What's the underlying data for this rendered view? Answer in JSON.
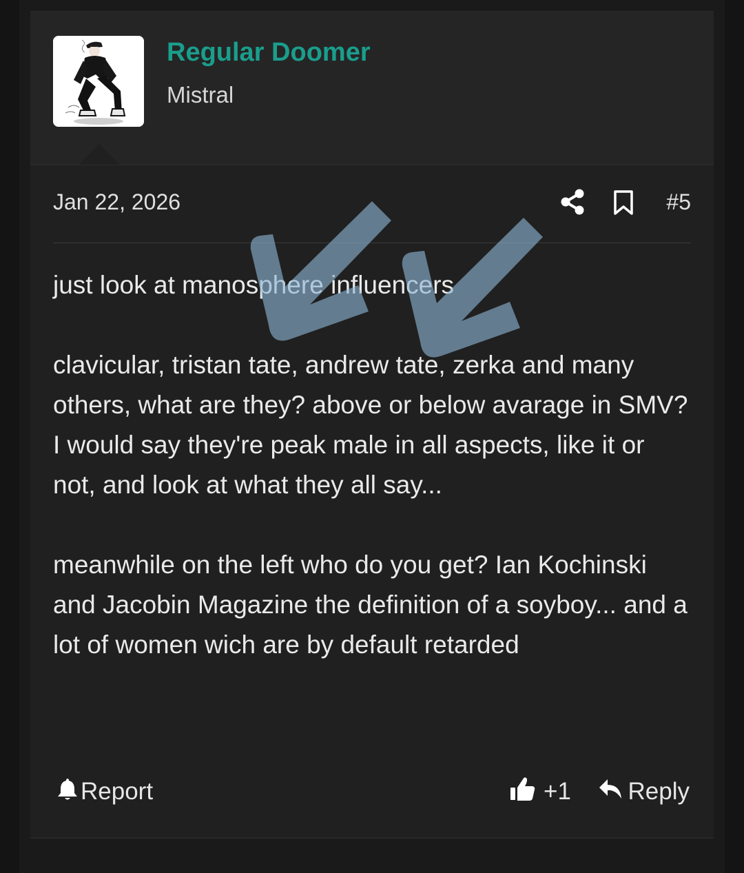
{
  "user": {
    "name": "Regular Doomer",
    "title": "Mistral"
  },
  "post": {
    "date": "Jan 22, 2026",
    "number": "#5",
    "paragraphs": [
      "just look at manosphere influencers",
      "clavicular, tristan tate, andrew tate, zerka and many others, what are they? above or below avarage in SMV? I would say they're peak male in all aspects, like it or not, and look at what they all say...",
      "meanwhile on the left who do you get? Ian Kochinski and Jacobin Magazine the definition of a soyboy... and a lot of women wich are by default retarded"
    ]
  },
  "actions": {
    "report_label": "Report",
    "like_count": "+1",
    "reply_label": "Reply"
  },
  "colors": {
    "username": "#1a9e8c",
    "background": "#202020",
    "header": "#252525",
    "text": "#eaeaea"
  },
  "icons": [
    "share-icon",
    "bookmark-icon",
    "bell-icon",
    "thumbs-up-icon",
    "reply-arrow-icon"
  ]
}
